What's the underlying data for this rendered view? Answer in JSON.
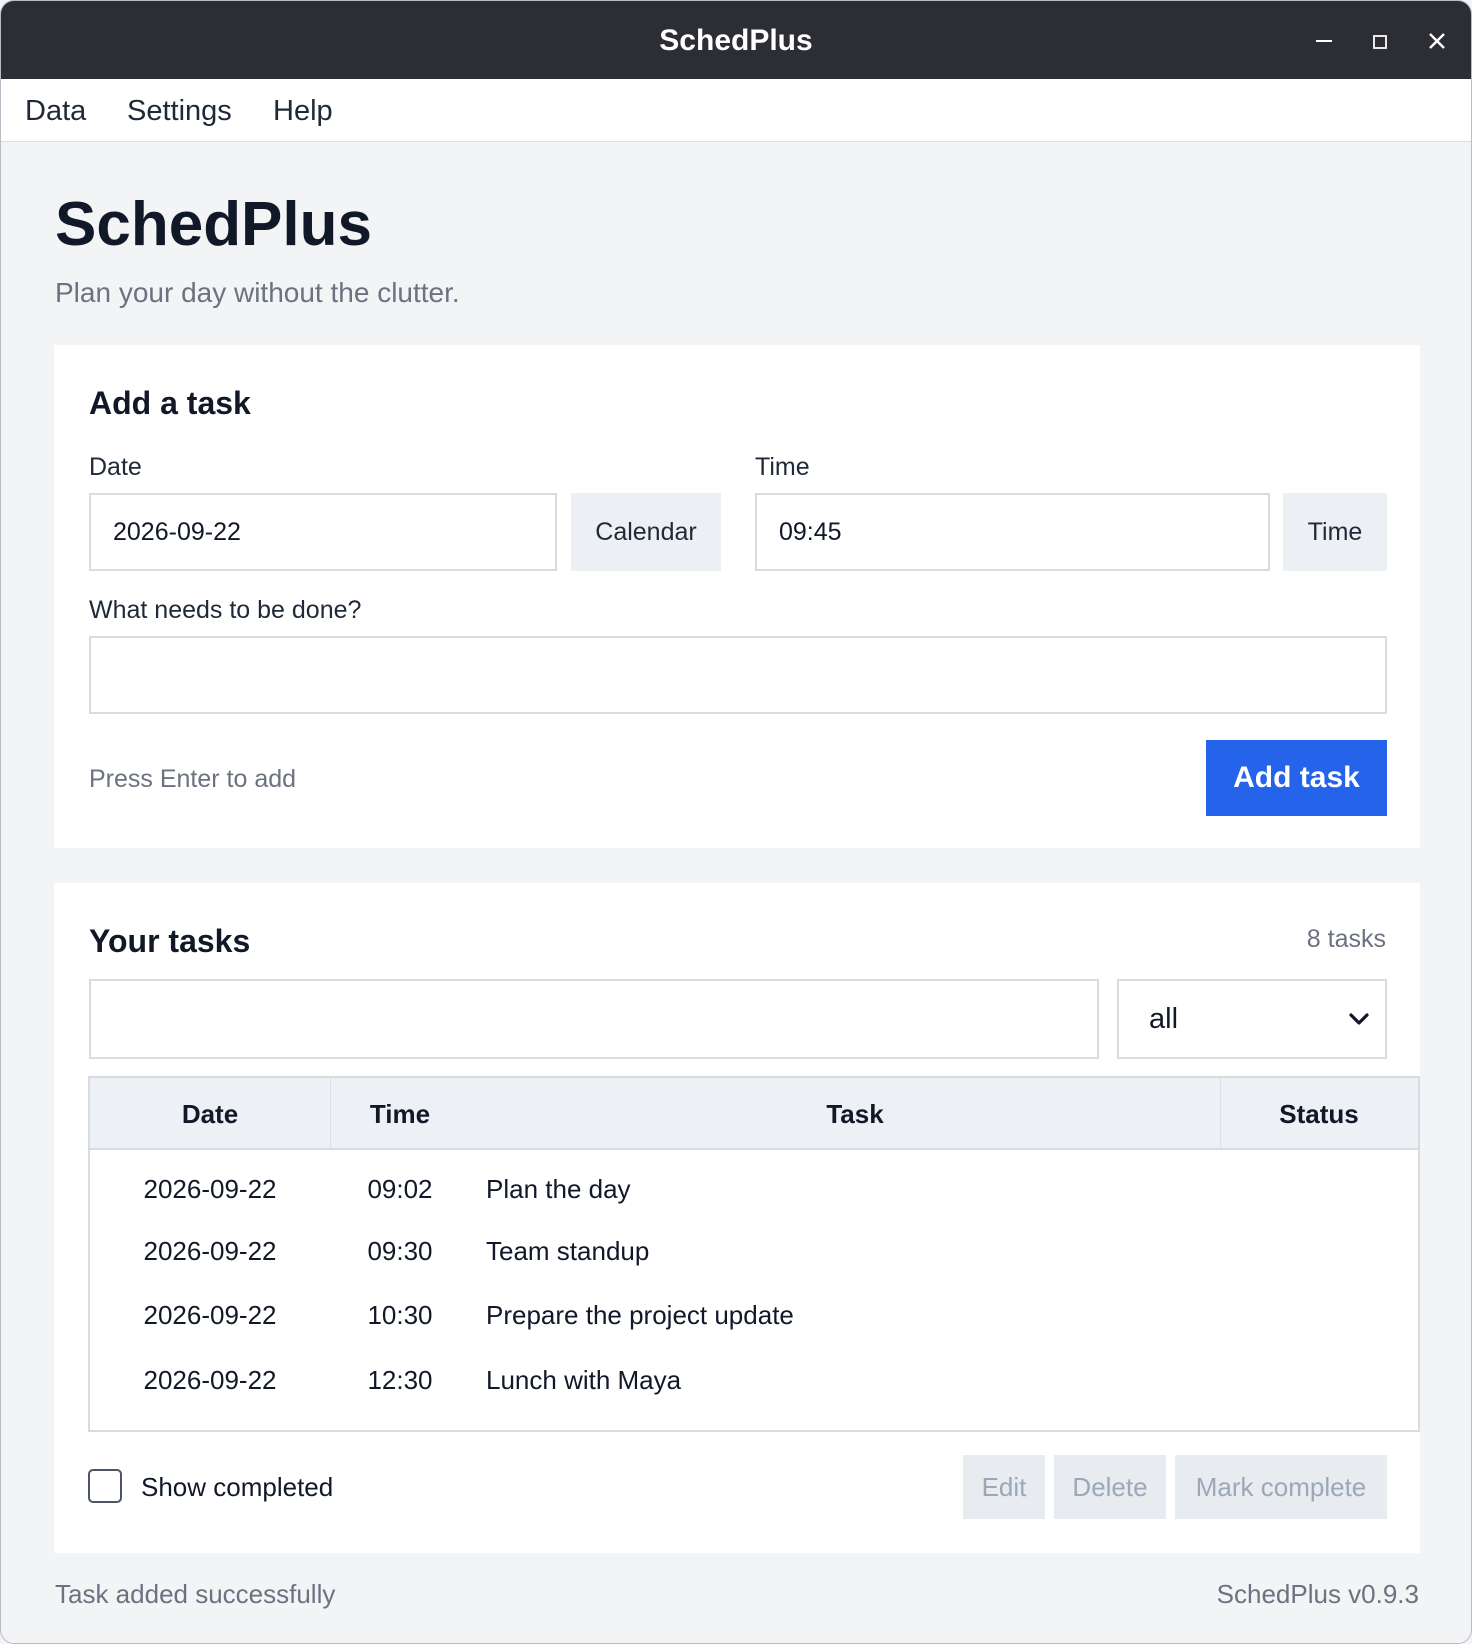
{
  "window": {
    "title": "SchedPlus",
    "controls": {
      "minimize_icon": "minimize-icon",
      "maximize_icon": "maximize-icon",
      "close_icon": "close-icon"
    }
  },
  "menu": {
    "items": [
      {
        "label": "Data"
      },
      {
        "label": "Settings"
      },
      {
        "label": "Help"
      }
    ]
  },
  "header": {
    "title": "SchedPlus",
    "subtitle": "Plan your day without the clutter."
  },
  "add_task": {
    "heading": "Add a task",
    "date_label": "Date",
    "date_value": "2026-09-22",
    "calendar_button": "Calendar",
    "time_label": "Time",
    "time_value": "09:45",
    "time_button": "Time",
    "task_label": "What needs to be done?",
    "task_value": "",
    "hint": "Press Enter to add",
    "add_button": "Add task"
  },
  "tasks": {
    "heading": "Your tasks",
    "count": "8 tasks",
    "search_value": "",
    "filter_selected": "all",
    "columns": {
      "date": "Date",
      "time": "Time",
      "task": "Task",
      "status": "Status"
    },
    "rows": [
      {
        "date": "2026-09-22",
        "time": "09:02",
        "task": "Plan the day",
        "status": ""
      },
      {
        "date": "2026-09-22",
        "time": "09:30",
        "task": "Team standup",
        "status": ""
      },
      {
        "date": "2026-09-22",
        "time": "10:30",
        "task": "Prepare the project update",
        "status": ""
      },
      {
        "date": "2026-09-22",
        "time": "12:30",
        "task": "Lunch with Maya",
        "status": ""
      }
    ],
    "show_completed_label": "Show completed",
    "show_completed_checked": false,
    "edit_button": "Edit",
    "delete_button": "Delete",
    "mark_complete_button": "Mark complete"
  },
  "statusbar": {
    "message": "Task added successfully",
    "version": "SchedPlus v0.9.3"
  },
  "colors": {
    "titlebar": "#2d2e33",
    "accent": "#2563eb",
    "background": "#f3f4f6",
    "card": "#ffffff"
  }
}
